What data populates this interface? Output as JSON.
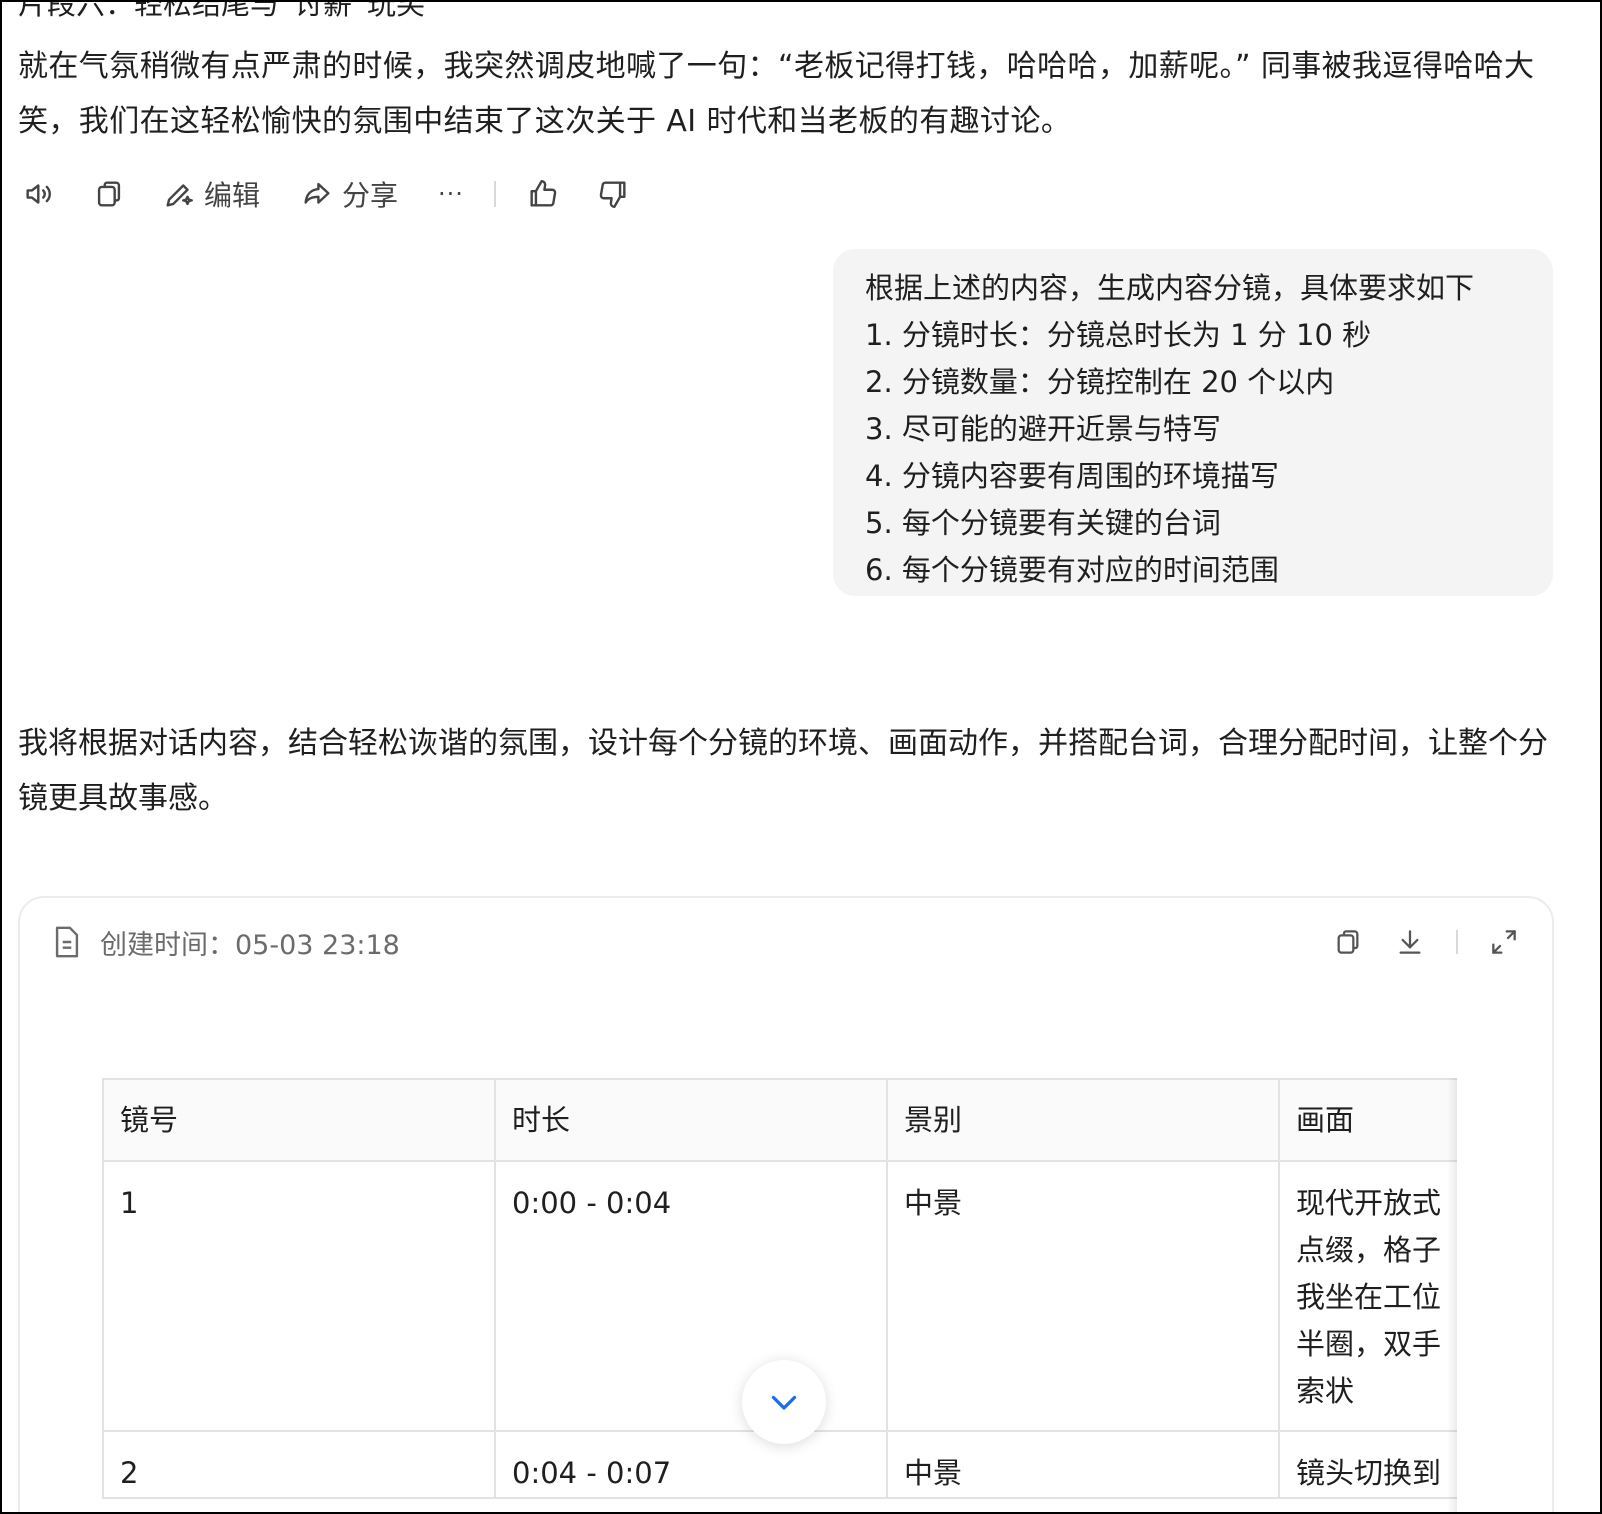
{
  "previous_message": {
    "heading": "片段六：轻松结尾与“讨薪”玩笑",
    "paragraph": "就在气氛稍微有点严肃的时候，我突然调皮地喊了一句：“老板记得打钱，哈哈哈，加薪呢。” 同事被我逗得哈哈大笑，我们在这轻松愉快的氛围中结束了这次关于 AI 时代和当老板的有趣讨论。"
  },
  "message_actions": {
    "edit_label": "编辑",
    "share_label": "分享",
    "more_label": "···"
  },
  "user_message": {
    "lines": [
      "根据上述的内容，生成内容分镜，具体要求如下",
      "1. 分镜时长：分镜总时长为 1 分 10 秒",
      "2. 分镜数量：分镜控制在 20 个以内",
      "3. 尽可能的避开近景与特写",
      "4. 分镜内容要有周围的环境描写",
      "5. 每个分镜要有关键的台词",
      "6. 每个分镜要有对应的时间范围"
    ]
  },
  "assistant_message": {
    "intro": "我将根据对话内容，结合轻松诙谐的氛围，设计每个分镜的环境、画面动作，并搭配台词，合理分配时间，让整个分镜更具故事感。"
  },
  "document": {
    "created_label": "创建时间：05-03 23:18",
    "table": {
      "headers": [
        "镜号",
        "时长",
        "景别",
        "画面"
      ],
      "rows": [
        {
          "no": "1",
          "duration": "0:00 - 0:04",
          "shot": "中景",
          "scene_lines": [
            "现代开放式",
            "点缀，格子",
            "我坐在工位",
            "半圈，双手",
            "索状"
          ]
        },
        {
          "no": "2",
          "duration": "0:04 - 0:07",
          "shot": "中景",
          "scene_lines": [
            "镜头切换到"
          ]
        }
      ]
    }
  },
  "icons": {
    "speaker": "speaker-icon",
    "copy": "copy-icon",
    "edit": "edit-icon",
    "share": "share-icon",
    "like": "thumbs-up-icon",
    "dislike": "thumbs-down-icon",
    "document": "document-icon",
    "download": "download-icon",
    "expand": "expand-icon",
    "scroll_down": "chevron-down-icon"
  },
  "colors": {
    "bubble_bg": "#f4f4f5",
    "accent_blue": "#1a6df0",
    "muted_text": "#6b6b6b"
  }
}
